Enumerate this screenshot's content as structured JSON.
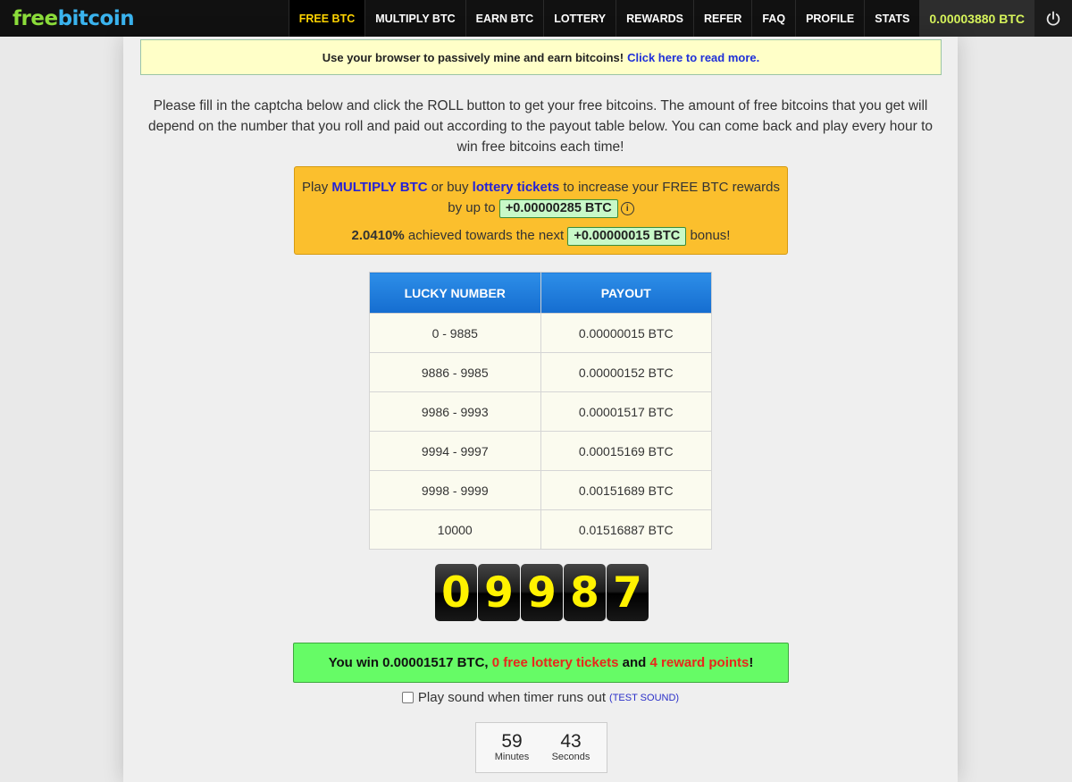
{
  "brand": {
    "free": "free",
    "bitcoin": "bitcoin"
  },
  "nav": {
    "items": [
      {
        "label": "FREE BTC",
        "active": true
      },
      {
        "label": "MULTIPLY BTC"
      },
      {
        "label": "EARN BTC"
      },
      {
        "label": "LOTTERY"
      },
      {
        "label": "REWARDS"
      },
      {
        "label": "REFER"
      },
      {
        "label": "FAQ"
      },
      {
        "label": "PROFILE"
      },
      {
        "label": "STATS"
      }
    ],
    "balance": "0.00003880 BTC"
  },
  "notice": {
    "text": "Use your browser to passively mine and earn bitcoins!",
    "link": "Click here to read more."
  },
  "intro": "Please fill in the captcha below and click the ROLL button to get your free bitcoins. The amount of free bitcoins that you get will depend on the number that you roll and paid out according to the payout table below. You can come back and play every hour to win free bitcoins each time!",
  "bonus": {
    "play": "Play",
    "multiply": "MULTIPLY BTC",
    "or_buy": "or buy",
    "lottery": "lottery tickets",
    "increase": "to increase your FREE BTC rewards by up to",
    "max_bonus": "+0.00000285 BTC",
    "percent": "2.0410%",
    "achieved": "achieved towards the next",
    "next_bonus": "+0.00000015 BTC",
    "bonus_word": "bonus!"
  },
  "payout_table": {
    "headers": [
      "LUCKY NUMBER",
      "PAYOUT"
    ],
    "rows": [
      [
        "0 - 9885",
        "0.00000015 BTC"
      ],
      [
        "9886 - 9985",
        "0.00000152 BTC"
      ],
      [
        "9986 - 9993",
        "0.00001517 BTC"
      ],
      [
        "9994 - 9997",
        "0.00015169 BTC"
      ],
      [
        "9998 - 9999",
        "0.00151689 BTC"
      ],
      [
        "10000",
        "0.01516887 BTC"
      ]
    ]
  },
  "roll": {
    "digits": [
      "0",
      "9",
      "9",
      "8",
      "7"
    ]
  },
  "win": {
    "prefix": "You win 0.00001517 BTC,",
    "tickets": "0 free lottery tickets",
    "and": "and",
    "points": "4 reward points",
    "suffix": "!"
  },
  "sound": {
    "label": "Play sound when timer runs out",
    "test": "(TEST SOUND)"
  },
  "timer": {
    "minutes": "59",
    "minutes_label": "Minutes",
    "seconds": "43",
    "seconds_label": "Seconds"
  }
}
